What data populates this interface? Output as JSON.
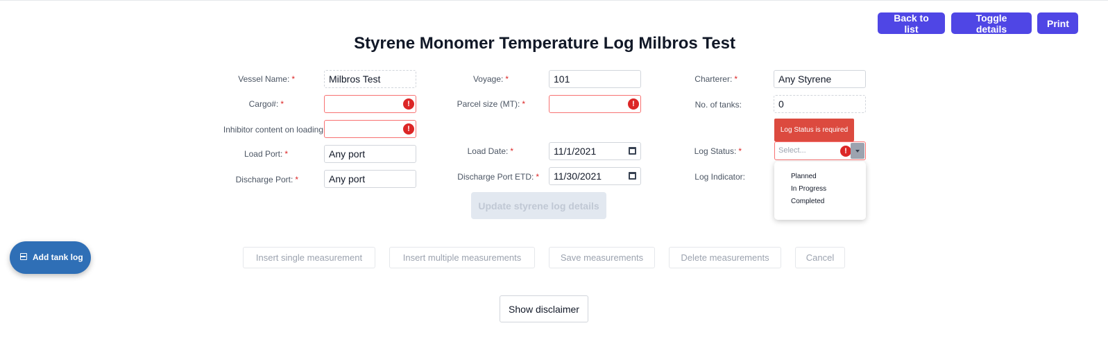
{
  "header": {
    "back_label": "Back to list",
    "toggle_label": "Toggle details",
    "print_label": "Print",
    "title": "Styrene Monomer Temperature Log Milbros Test"
  },
  "form": {
    "vessel_name": {
      "label": "Vessel Name:",
      "value": "Milbros Test",
      "required": "*"
    },
    "cargo": {
      "label": "Cargo#:",
      "value": "",
      "required": "*"
    },
    "inhibitor": {
      "label": "Inhibitor content on loading",
      "value": ""
    },
    "load_port": {
      "label": "Load Port:",
      "value": "Any port",
      "required": "*"
    },
    "discharge_port": {
      "label": "Discharge Port:",
      "value": "Any port",
      "required": "*"
    },
    "voyage": {
      "label": "Voyage:",
      "value": "101",
      "required": "*"
    },
    "parcel_size": {
      "label": "Parcel size (MT):",
      "value": "",
      "required": "*"
    },
    "load_date": {
      "label": "Load Date:",
      "value": "11/1/2021",
      "required": "*"
    },
    "discharge_etd": {
      "label": "Discharge Port ETD:",
      "value": "11/30/2021",
      "required": "*"
    },
    "charterer": {
      "label": "Charterer:",
      "value": "Any Styrene",
      "required": "*"
    },
    "tanks": {
      "label": "No. of tanks:",
      "value": "0"
    },
    "log_status": {
      "label": "Log Status:",
      "required": "*",
      "placeholder": "Select...",
      "error": "Log Status is required",
      "options": [
        "Planned",
        "In Progress",
        "Completed"
      ]
    },
    "log_indicator": {
      "label": "Log Indicator:"
    },
    "error_glyph": "!",
    "update_label": "Update styrene log details"
  },
  "measurements": {
    "insert_single": "Insert single measurement",
    "insert_multiple": "Insert multiple measurements",
    "save": "Save measurements",
    "delete": "Delete measurements",
    "cancel": "Cancel"
  },
  "fab": {
    "label": "Add tank log",
    "icon": "table-icon"
  },
  "footer": {
    "disclaimer_label": "Show disclaimer"
  },
  "colors": {
    "primary": "#4f46e5",
    "error": "#dc2626",
    "fab": "#2f6fb6"
  }
}
